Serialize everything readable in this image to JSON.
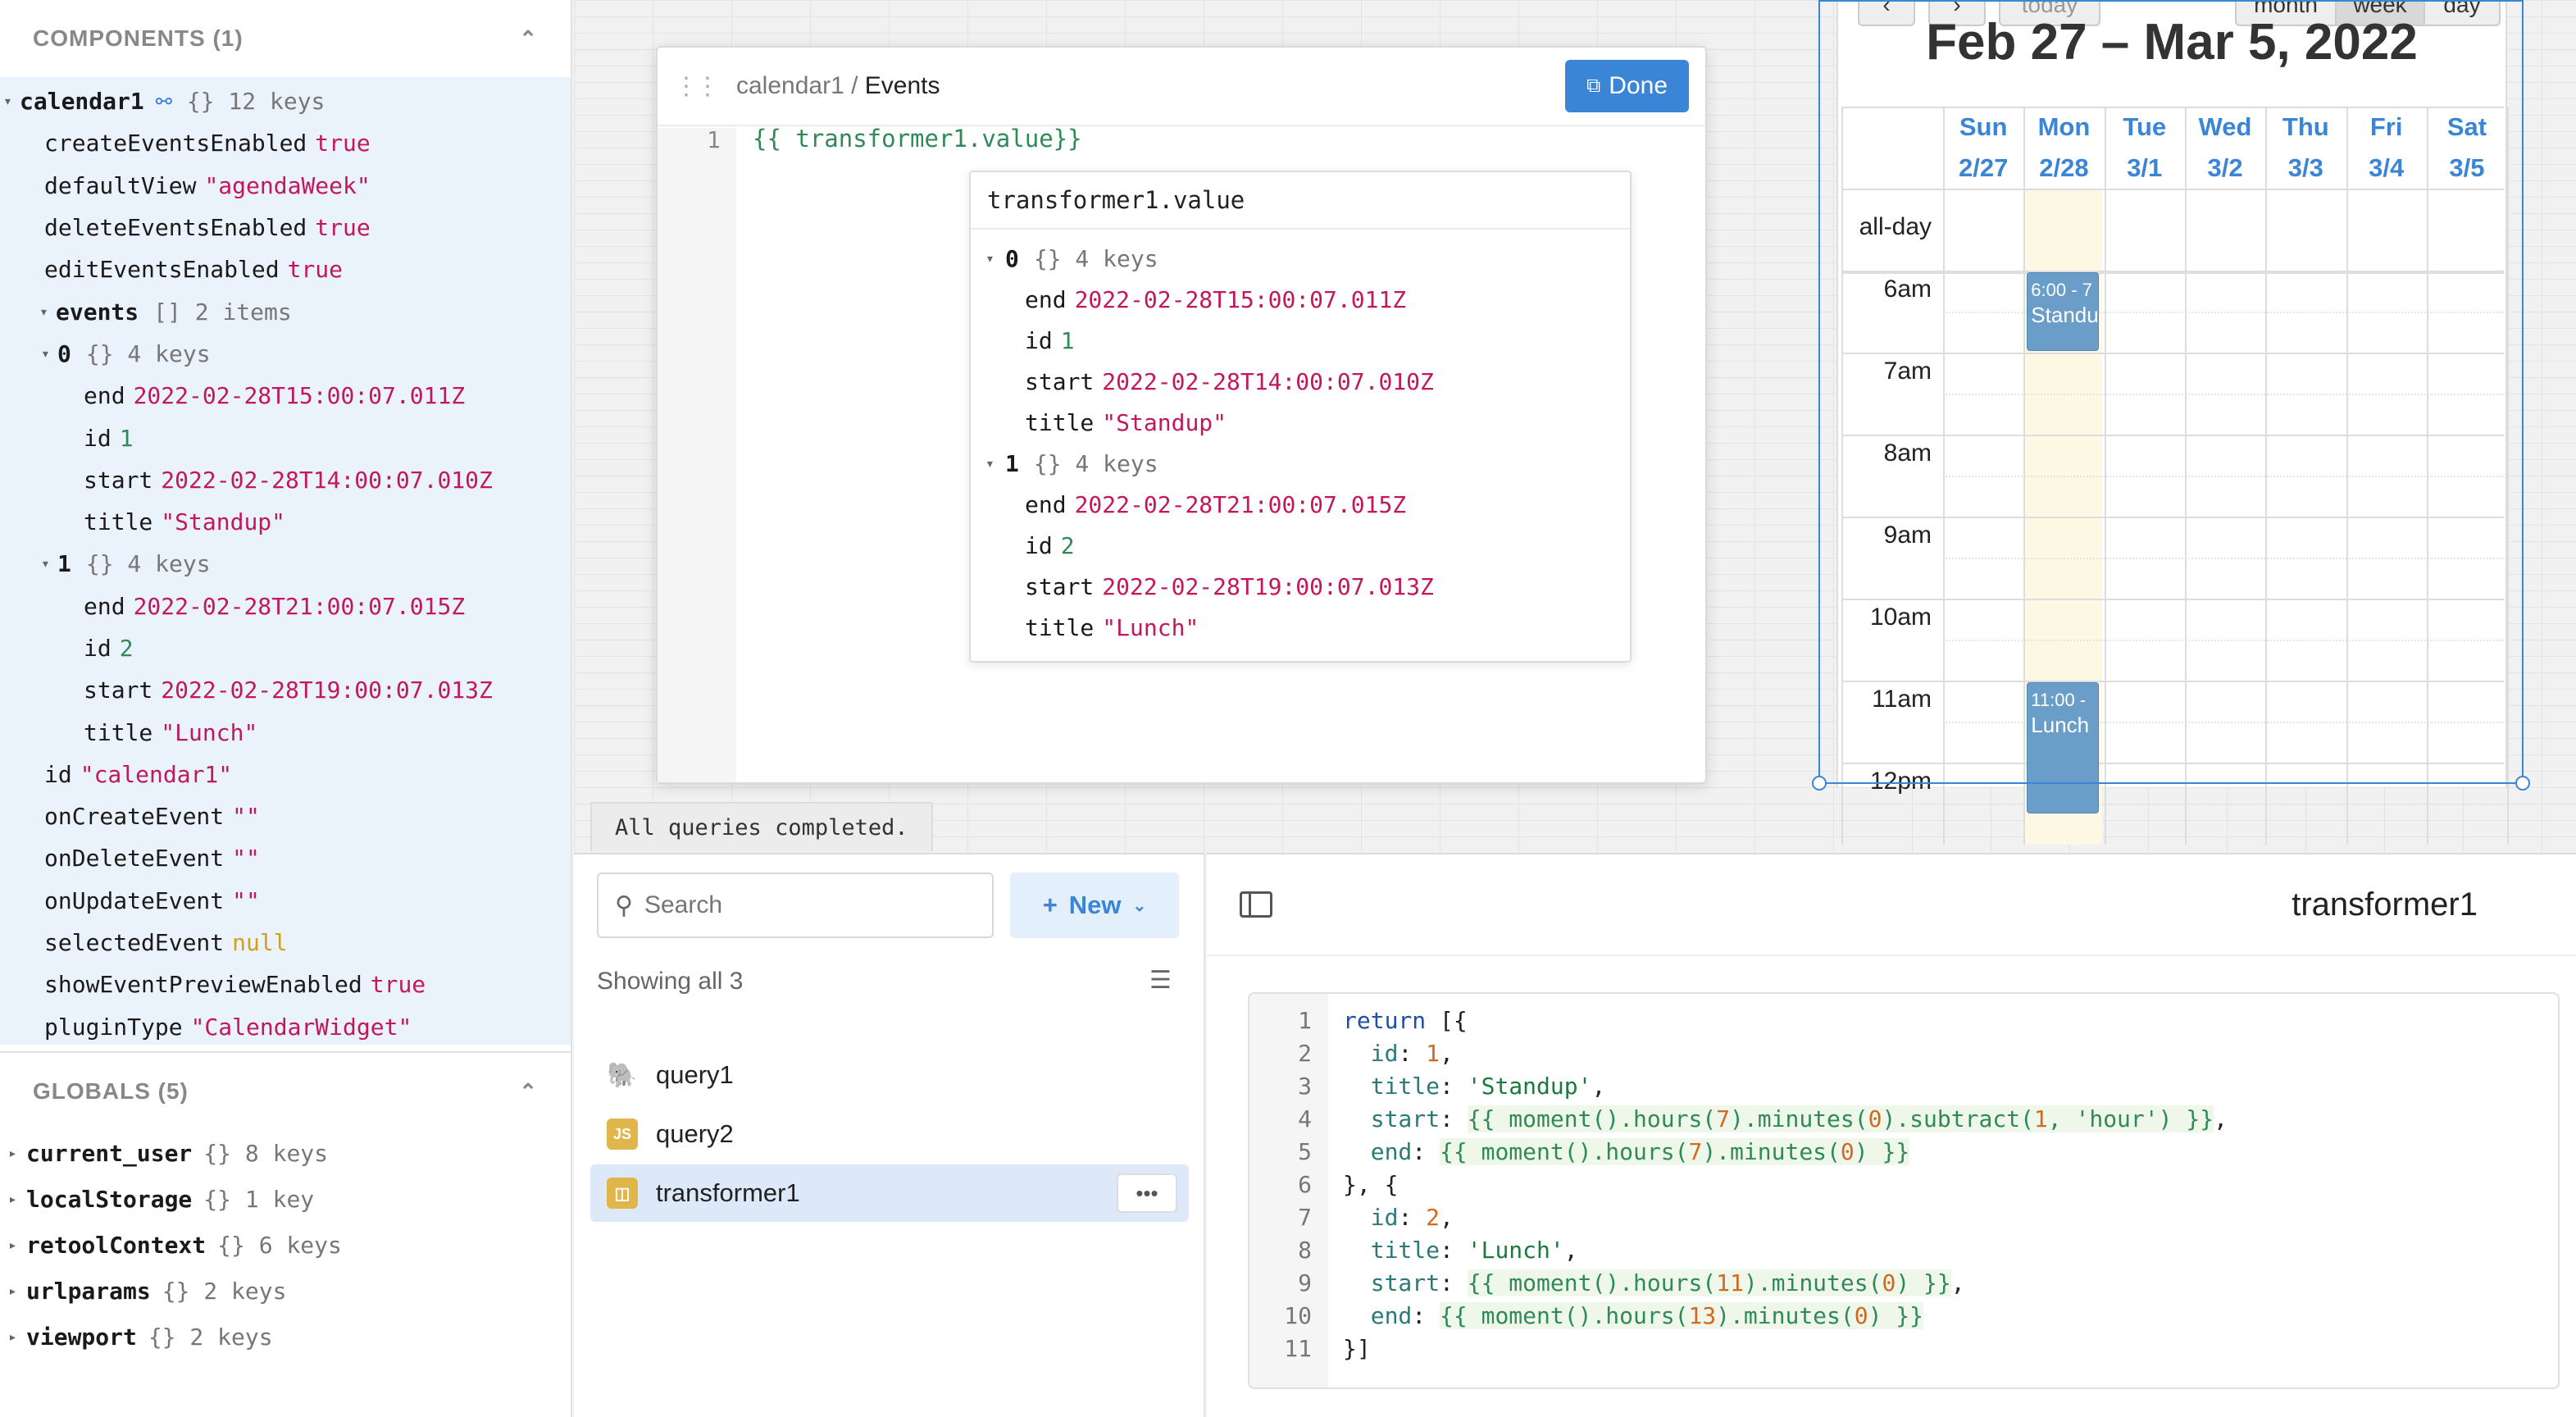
{
  "state_panel": {
    "components_header": "COMPONENTS (1)",
    "globals_header": "GLOBALS (5)",
    "calendar_rows": [
      {
        "key": "calendar1",
        "meta": "{}  12 keys",
        "bold": true,
        "indent": 0,
        "tri": "▾"
      },
      {
        "key": "createEventsEnabled",
        "value": "true",
        "vclass": "vb",
        "indent": 1
      },
      {
        "key": "defaultView",
        "value": "\"agendaWeek\"",
        "vclass": "vs",
        "indent": 1
      },
      {
        "key": "deleteEventsEnabled",
        "value": "true",
        "vclass": "vb",
        "indent": 1
      },
      {
        "key": "editEventsEnabled",
        "value": "true",
        "vclass": "vb",
        "indent": 1
      },
      {
        "key": "events",
        "meta": "[]  2 items",
        "bold": true,
        "indent": 1,
        "tri": "▾"
      },
      {
        "key": "0",
        "meta": "{}  4 keys",
        "bold": true,
        "indent": 2,
        "tri": "▾"
      },
      {
        "key": "end",
        "value": "2022-02-28T15:00:07.011Z",
        "vclass": "vs",
        "indent": 3
      },
      {
        "key": "id",
        "value": "1",
        "vclass": "vn",
        "indent": 3
      },
      {
        "key": "start",
        "value": "2022-02-28T14:00:07.010Z",
        "vclass": "vs",
        "indent": 3
      },
      {
        "key": "title",
        "value": "\"Standup\"",
        "vclass": "vs",
        "indent": 3
      },
      {
        "key": "1",
        "meta": "{}  4 keys",
        "bold": true,
        "indent": 2,
        "tri": "▾"
      },
      {
        "key": "end",
        "value": "2022-02-28T21:00:07.015Z",
        "vclass": "vs",
        "indent": 3
      },
      {
        "key": "id",
        "value": "2",
        "vclass": "vn",
        "indent": 3
      },
      {
        "key": "start",
        "value": "2022-02-28T19:00:07.013Z",
        "vclass": "vs",
        "indent": 3
      },
      {
        "key": "title",
        "value": "\"Lunch\"",
        "vclass": "vs",
        "indent": 3
      },
      {
        "key": "id",
        "value": "\"calendar1\"",
        "vclass": "vs",
        "indent": 1
      },
      {
        "key": "onCreateEvent",
        "value": "\"\"",
        "vclass": "vs",
        "indent": 1
      },
      {
        "key": "onDeleteEvent",
        "value": "\"\"",
        "vclass": "vs",
        "indent": 1
      },
      {
        "key": "onUpdateEvent",
        "value": "\"\"",
        "vclass": "vs",
        "indent": 1
      },
      {
        "key": "selectedEvent",
        "value": "null",
        "vclass": "vnull",
        "indent": 1
      },
      {
        "key": "showEventPreviewEnabled",
        "value": "true",
        "vclass": "vb",
        "indent": 1
      },
      {
        "key": "pluginType",
        "value": "\"CalendarWidget\"",
        "vclass": "vs",
        "indent": 1
      }
    ],
    "globals": [
      {
        "key": "current_user",
        "meta": "{}  8 keys"
      },
      {
        "key": "localStorage",
        "meta": "{}  1 key"
      },
      {
        "key": "retoolContext",
        "meta": "{}  6 keys"
      },
      {
        "key": "urlparams",
        "meta": "{}  2 keys"
      },
      {
        "key": "viewport",
        "meta": "{}  2 keys"
      }
    ]
  },
  "events_modal": {
    "breadcrumb_parent": "calendar1",
    "breadcrumb_sep": " / ",
    "breadcrumb_current": "Events",
    "done_label": "Done",
    "line_number": "1",
    "code": "{{ transformer1.value}}"
  },
  "popup": {
    "title": "transformer1.value",
    "rows": [
      {
        "key": "0",
        "meta": "{}  4 keys",
        "bold": true,
        "indent": 0,
        "tri": "▾"
      },
      {
        "key": "end",
        "value": "2022-02-28T15:00:07.011Z",
        "vclass": "vs",
        "indent": 1
      },
      {
        "key": "id",
        "value": "1",
        "vclass": "vn",
        "indent": 1
      },
      {
        "key": "start",
        "value": "2022-02-28T14:00:07.010Z",
        "vclass": "vs",
        "indent": 1
      },
      {
        "key": "title",
        "value": "\"Standup\"",
        "vclass": "vs",
        "indent": 1
      },
      {
        "key": "1",
        "meta": "{}  4 keys",
        "bold": true,
        "indent": 0,
        "tri": "▾"
      },
      {
        "key": "end",
        "value": "2022-02-28T21:00:07.015Z",
        "vclass": "vs",
        "indent": 1
      },
      {
        "key": "id",
        "value": "2",
        "vclass": "vn",
        "indent": 1
      },
      {
        "key": "start",
        "value": "2022-02-28T19:00:07.013Z",
        "vclass": "vs",
        "indent": 1
      },
      {
        "key": "title",
        "value": "\"Lunch\"",
        "vclass": "vs",
        "indent": 1
      }
    ]
  },
  "calendar": {
    "title": "Feb 27 – Mar 5, 2022",
    "nav": {
      "today": "today",
      "month": "month",
      "week": "week",
      "day": "day"
    },
    "days": [
      {
        "name": "Sun",
        "date": "2/27"
      },
      {
        "name": "Mon",
        "date": "2/28"
      },
      {
        "name": "Tue",
        "date": "3/1"
      },
      {
        "name": "Wed",
        "date": "3/2"
      },
      {
        "name": "Thu",
        "date": "3/3"
      },
      {
        "name": "Fri",
        "date": "3/4"
      },
      {
        "name": "Sat",
        "date": "3/5"
      }
    ],
    "all_day_label": "all-day",
    "hours": [
      "6am",
      "7am",
      "8am",
      "9am",
      "10am",
      "11am",
      "12pm"
    ],
    "events": [
      {
        "time": "6:00 - 7",
        "title": "Standu"
      },
      {
        "time": "11:00 -",
        "title": "Lunch"
      }
    ]
  },
  "status_text": "All queries completed.",
  "query_panel": {
    "search_placeholder": "Search",
    "new_label": "New",
    "showing_label": "Showing all 3",
    "items": [
      {
        "name": "query1",
        "icon": "postgres-icon"
      },
      {
        "name": "query2",
        "icon": "js-icon"
      },
      {
        "name": "transformer1",
        "icon": "transformer-icon"
      }
    ],
    "js_icon_text": "JS"
  },
  "editor": {
    "title": "transformer1"
  },
  "colors": {
    "accent": "#3a85d6",
    "string": "#c2185b",
    "number": "#2e8b57",
    "null": "#d4a017",
    "today_bg": "#fcf8e3",
    "event_bg": "#6a9ec9"
  }
}
